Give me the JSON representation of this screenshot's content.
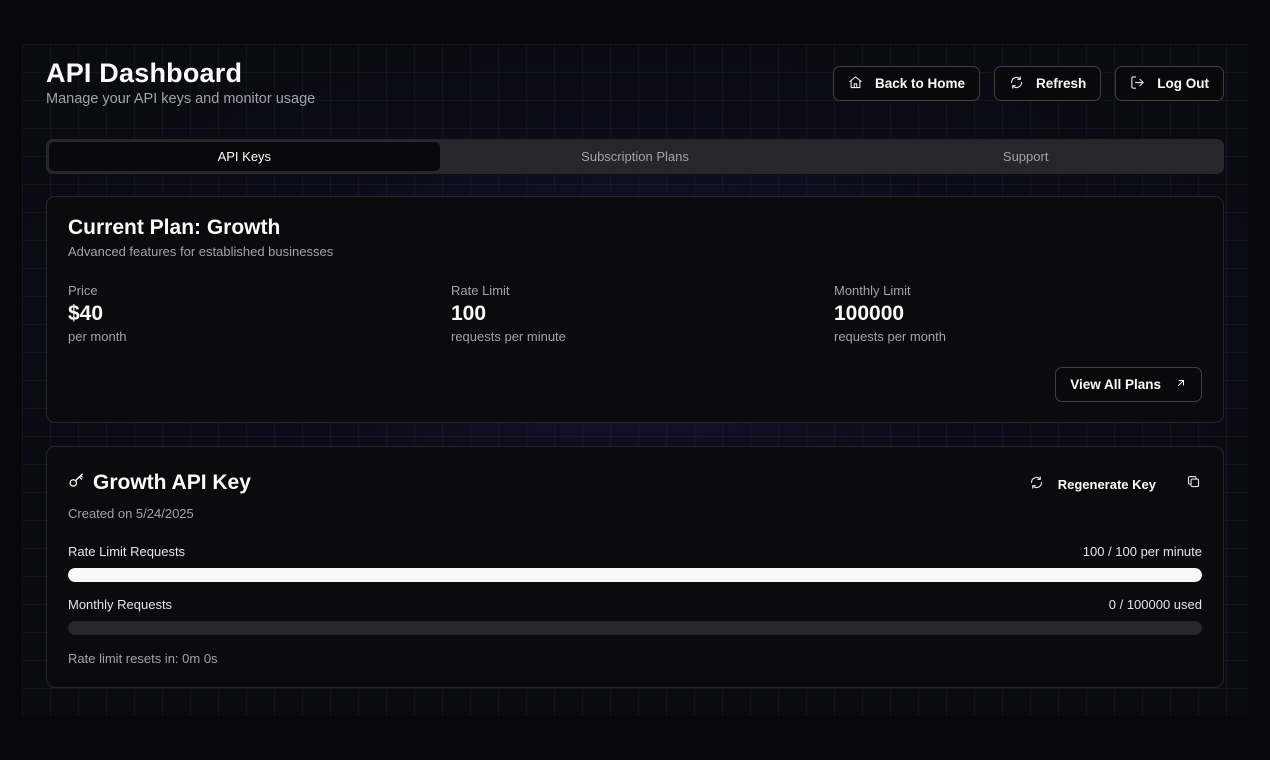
{
  "header": {
    "title": "API Dashboard",
    "subtitle": "Manage your API keys and monitor usage",
    "actions": {
      "home_label": "Back to Home",
      "refresh_label": "Refresh",
      "logout_label": "Log Out"
    }
  },
  "tabs": [
    {
      "label": "API Keys",
      "active": true
    },
    {
      "label": "Subscription Plans",
      "active": false
    },
    {
      "label": "Support",
      "active": false
    }
  ],
  "plan": {
    "title": "Current Plan: Growth",
    "description": "Advanced features for established businesses",
    "stats": [
      {
        "label": "Price",
        "value": "$40",
        "unit": "per month"
      },
      {
        "label": "Rate Limit",
        "value": "100",
        "unit": "requests per minute"
      },
      {
        "label": "Monthly Limit",
        "value": "100000",
        "unit": "requests per month"
      }
    ],
    "view_all_label": "View All Plans"
  },
  "api_key": {
    "title": "Growth API Key",
    "created": "Created on 5/24/2025",
    "regenerate_label": "Regenerate Key",
    "rate_limit": {
      "label": "Rate Limit Requests",
      "value_text": "100 / 100 per minute",
      "used": 100,
      "limit": 100
    },
    "monthly": {
      "label": "Monthly Requests",
      "value_text": "0 / 100000 used",
      "used": 0,
      "limit": 100000
    },
    "reset_text": "Rate limit resets in: 0m 0s"
  },
  "icons": {
    "home": "home-icon",
    "refresh": "refresh-icon",
    "logout": "logout-icon",
    "arrow": "arrow-up-right-icon",
    "key": "key-icon",
    "copy": "copy-icon"
  },
  "colors": {
    "background": "#07070c",
    "card": "#0b0b0d",
    "border": "#27272a",
    "muted_text": "#a1a1aa",
    "accent_glow": "#302a78",
    "bar_fill": "#fafafa",
    "bar_track": "#27272a"
  }
}
